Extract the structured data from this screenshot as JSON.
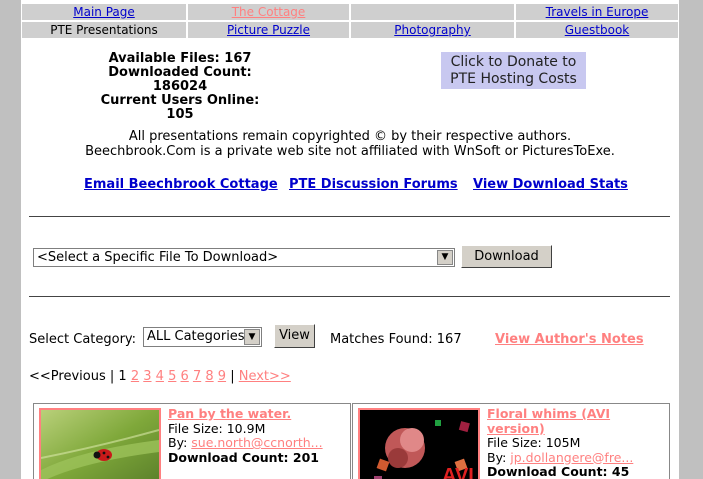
{
  "nav": {
    "row1": [
      {
        "label": "Main Page",
        "link": true
      },
      {
        "label": "The Cottage",
        "link": true,
        "active": true
      },
      {
        "label": "",
        "link": false
      },
      {
        "label": "Travels in Europe",
        "link": true
      }
    ],
    "row2": [
      {
        "label": "PTE Presentations",
        "link": false
      },
      {
        "label": "Picture Puzzle",
        "link": true
      },
      {
        "label": "Photography",
        "link": true
      },
      {
        "label": "Guestbook",
        "link": true
      }
    ]
  },
  "stats": {
    "available": "Available Files: 167",
    "downloaded": "Downloaded Count: 186024",
    "online": "Current Users Online: 105"
  },
  "donate": {
    "line1": "Click to Donate to",
    "line2": "PTE Hosting Costs"
  },
  "copyright": {
    "line1": "All presentations remain copyrighted © by their respective authors.",
    "line2": "Beechbrook.Com is a private web site not affiliated with WnSoft or PicturesToExe."
  },
  "links": {
    "email": "Email Beechbrook Cottage",
    "forums": "PTE Discussion Forums",
    "stats": "View Download Stats"
  },
  "download": {
    "select_value": "<Select a Specific File To Download>",
    "button": "Download"
  },
  "category": {
    "label": "Select Category:",
    "value": "ALL Categories",
    "button": "View",
    "matches": "Matches Found: 167",
    "author_notes": "View Author's Notes"
  },
  "pager": {
    "prev": "<<Previous",
    "sep": "|",
    "current": "1",
    "pages": [
      "2",
      "3",
      "4",
      "5",
      "6",
      "7",
      "8",
      "9"
    ],
    "next": "Next>>"
  },
  "cards": [
    {
      "title": "Pan by the water.",
      "size": "File Size: 10.9M",
      "by_label": "By:",
      "author": "sue.north@ccnorth...",
      "downloads": "Download Count: 201",
      "thumb": "ladybug-photo"
    },
    {
      "title": "Floral whims (AVI version)",
      "size": "File Size: 105M",
      "by_label": "By:",
      "author": "jp.dollangere@fre...",
      "downloads": "Download Count: 45",
      "thumb": "flowers-avi-photo",
      "thumb_text": "AVI"
    }
  ]
}
